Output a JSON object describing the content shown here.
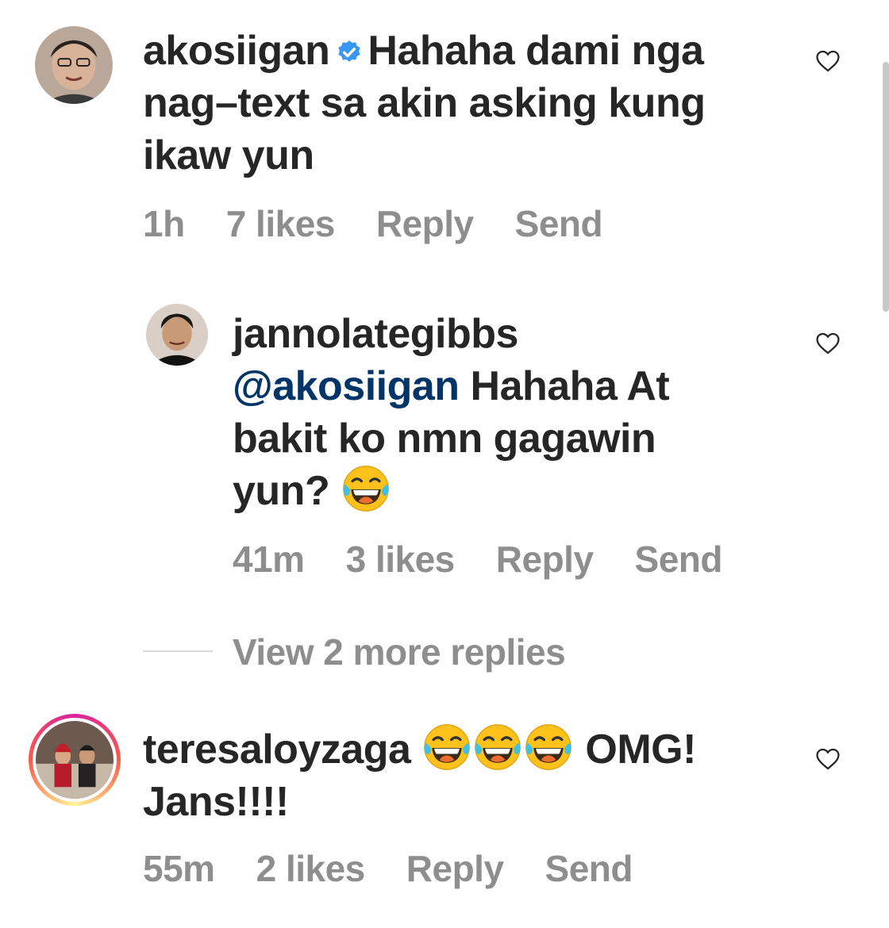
{
  "comments": [
    {
      "username": "akosiigan",
      "verified": true,
      "text_lines": [
        "Hahaha dami nga",
        "nag–text sa akin asking kung",
        "ikaw yun"
      ],
      "time": "1h",
      "likes": "7 likes",
      "reply_label": "Reply",
      "send_label": "Send"
    },
    {
      "username": "jannolategibbs",
      "mention": "@akosiigan",
      "text_line1_rest": " Hahaha At",
      "text_line2": "bakit ko nmn gagawin",
      "text_line3": "yun?",
      "emoji": "face-with-tears-of-joy",
      "time": "41m",
      "likes": "3 likes",
      "reply_label": "Reply",
      "send_label": "Send"
    },
    {
      "username": "teresaloyzaga",
      "emojis": [
        "face-with-tears-of-joy",
        "face-with-tears-of-joy",
        "face-with-tears-of-joy"
      ],
      "text_after": "OMG!",
      "text_line2": "Jans!!!!",
      "time": "55m",
      "likes": "2 likes",
      "reply_label": "Reply",
      "send_label": "Send"
    }
  ],
  "view_more_replies": "View 2 more replies",
  "colors": {
    "text": "#262626",
    "meta": "#8e8e8e",
    "mention": "#003569",
    "verified": "#3897f0"
  }
}
